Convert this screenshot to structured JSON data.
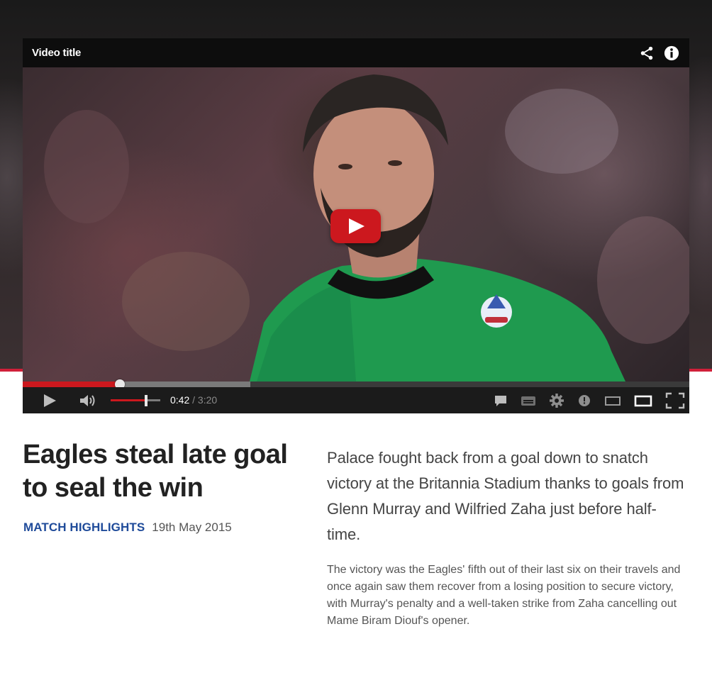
{
  "player": {
    "title": "Video title",
    "current_time": "0:42",
    "separator": " / ",
    "duration": "3:20",
    "played_fraction": 0.146,
    "buffered_fraction": 0.341,
    "volume_fraction": 0.71,
    "icons": {
      "share": "share-icon",
      "info": "info-icon",
      "play": "play-icon",
      "volume": "volume-icon",
      "comments": "comment-icon",
      "captions": "captions-icon",
      "settings": "gear-icon",
      "watch_later": "clock-icon",
      "small_player": "small-player-icon",
      "theater": "theater-icon",
      "fullscreen": "fullscreen-icon"
    },
    "colors": {
      "accent": "#cc181e",
      "bar": "#1b1b1b"
    }
  },
  "article": {
    "headline": "Eagles steal late goal to seal the win",
    "category": "MATCH HIGHLIGHTS",
    "date": "19th May 2015",
    "lede": "Palace fought back from a goal down to snatch victory at the Britannia Stadium thanks to goals from Glenn Murray and Wilfried Zaha just before half-time.",
    "body": "The victory was the Eagles' fifth out of their last six on their travels and once again saw them recover from a losing position to secure victory, with Murray's penalty and a well-taken strike from Zaha cancelling out Mame Biram Diouf's opener."
  },
  "colors": {
    "brand_red": "#d0203a",
    "category_blue": "#1f4b9a"
  }
}
